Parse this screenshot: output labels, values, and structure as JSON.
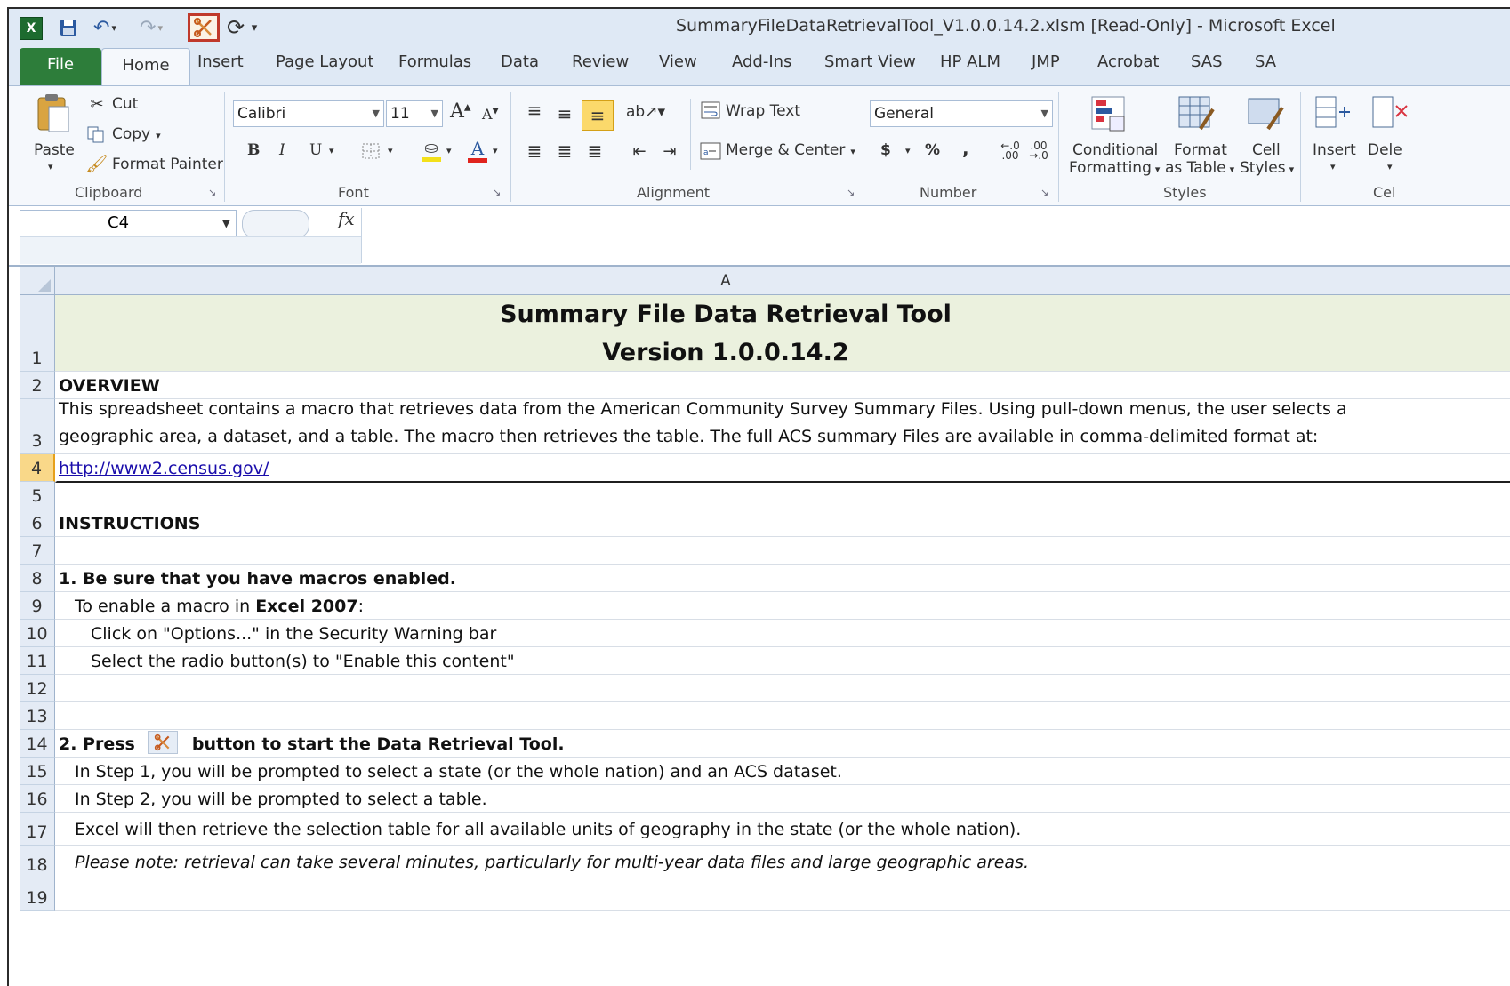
{
  "window": {
    "title": "SummaryFileDataRetrievalTool_V1.0.0.14.2.xlsm  [Read-Only]  -  Microsoft Excel"
  },
  "quick_access": {
    "excel_logo": "X",
    "save_icon": "💾",
    "undo_icon": "↶",
    "redo_icon": "↷",
    "macro_icon": "✂",
    "refresh_icon": "⟳",
    "customize_icon": "▾"
  },
  "tabs": [
    "File",
    "Home",
    "Insert",
    "Page Layout",
    "Formulas",
    "Data",
    "Review",
    "View",
    "Add-Ins",
    "Smart View",
    "HP ALM",
    "JMP",
    "Acrobat",
    "SAS",
    "SA"
  ],
  "ribbon": {
    "clipboard": {
      "label": "Clipboard",
      "paste": "Paste",
      "cut": "Cut",
      "copy": "Copy",
      "format_painter": "Format Painter"
    },
    "font": {
      "label": "Font",
      "font_name": "Calibri",
      "font_size": "11",
      "grow": "A",
      "shrink": "A",
      "bold": "B",
      "italic": "I",
      "underline": "U",
      "font_color_glyph": "A"
    },
    "alignment": {
      "label": "Alignment",
      "wrap_text": "Wrap Text",
      "merge_center": "Merge & Center"
    },
    "number": {
      "label": "Number",
      "format": "General",
      "currency": "$",
      "percent": "%",
      "comma": ","
    },
    "styles": {
      "label": "Styles",
      "conditional_1": "Conditional",
      "conditional_2": "Formatting",
      "format_1": "Format",
      "format_2": "as Table",
      "cell_1": "Cell",
      "cell_2": "Styles"
    },
    "cells": {
      "label": "Cel",
      "insert": "Insert",
      "delete": "Dele"
    }
  },
  "formula_bar": {
    "name_box": "C4",
    "fx": "fx",
    "content": ""
  },
  "sheet": {
    "column_header": "A",
    "selected_row": 4,
    "title_line1": "Summary File Data Retrieval Tool",
    "title_line2": "Version 1.0.0.14.2",
    "rows": {
      "r2": "OVERVIEW",
      "r3a": "This spreadsheet contains a macro that retrieves data from the American Community Survey Summary Files. Using pull-down menus, the user selects a",
      "r3b": "geographic area, a dataset, and a table. The macro then retrieves the table. The full ACS summary Files are available in comma-delimited format at:",
      "r4": "http://www2.census.gov/",
      "r6": "INSTRUCTIONS",
      "r8": "1. Be sure that you have macros enabled.",
      "r9_pre": "To enable a macro in ",
      "r9_bold": "Excel 2007",
      "r9_post": ":",
      "r10": "Click on \"Options...\" in the Security Warning bar",
      "r11": "Select the radio button(s) to \"Enable this content\"",
      "r14_pre": "2. Press",
      "r14_post": "button to start the Data Retrieval Tool.",
      "r15": "In Step 1, you will be prompted to select a state (or the whole nation) and an ACS dataset.",
      "r16": "In Step 2, you will be prompted to select a table.",
      "r17": "Excel will then retrieve the selection table  for all available units of geography in the state (or the whole nation).",
      "r18": "Please note: retrieval can take several minutes, particularly for multi-year data files and large geographic areas."
    },
    "row_numbers": [
      "1",
      "2",
      "3",
      "4",
      "5",
      "6",
      "7",
      "8",
      "9",
      "10",
      "11",
      "12",
      "13",
      "14",
      "15",
      "16",
      "17",
      "18",
      "19"
    ]
  }
}
